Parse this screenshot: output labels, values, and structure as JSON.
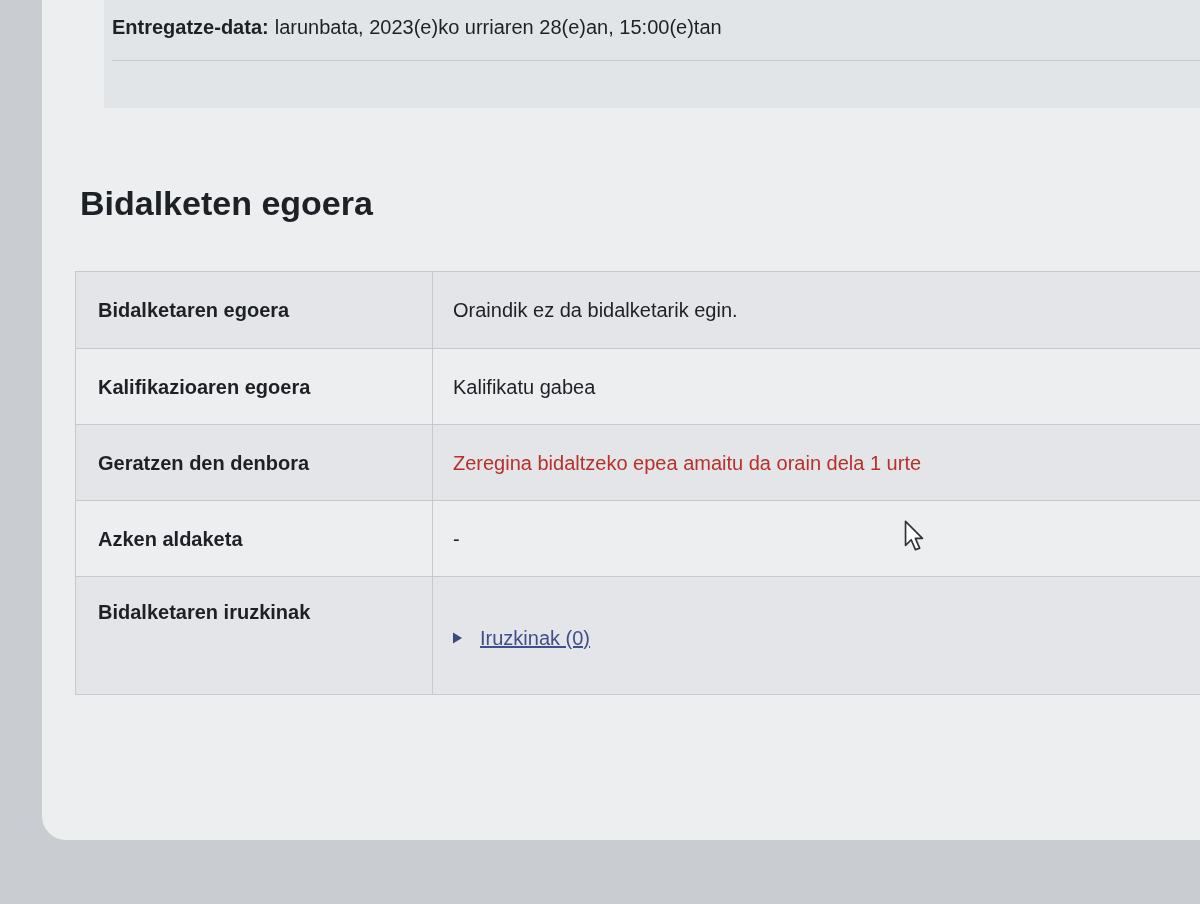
{
  "due_date": {
    "label": "Entregatze-data:",
    "value": "larunbata, 2023(e)ko urriaren 28(e)an, 15:00(e)tan"
  },
  "heading": "Bidalketen egoera",
  "table": {
    "rows": [
      {
        "kind": "text",
        "label": "Bidalketaren egoera",
        "value": "Oraindik ez da bidalketarik egin."
      },
      {
        "kind": "text",
        "label": "Kalifikazioaren egoera",
        "value": "Kalifikatu gabea"
      },
      {
        "kind": "overdue",
        "label": "Geratzen den denbora",
        "value": "Zeregina bidaltzeko epea amaitu da orain dela 1 urte"
      },
      {
        "kind": "text",
        "label": "Azken aldaketa",
        "value": "-"
      },
      {
        "kind": "comments",
        "label": "Bidalketaren iruzkinak",
        "link": "Iruzkinak (0)",
        "expanded": false
      }
    ]
  }
}
